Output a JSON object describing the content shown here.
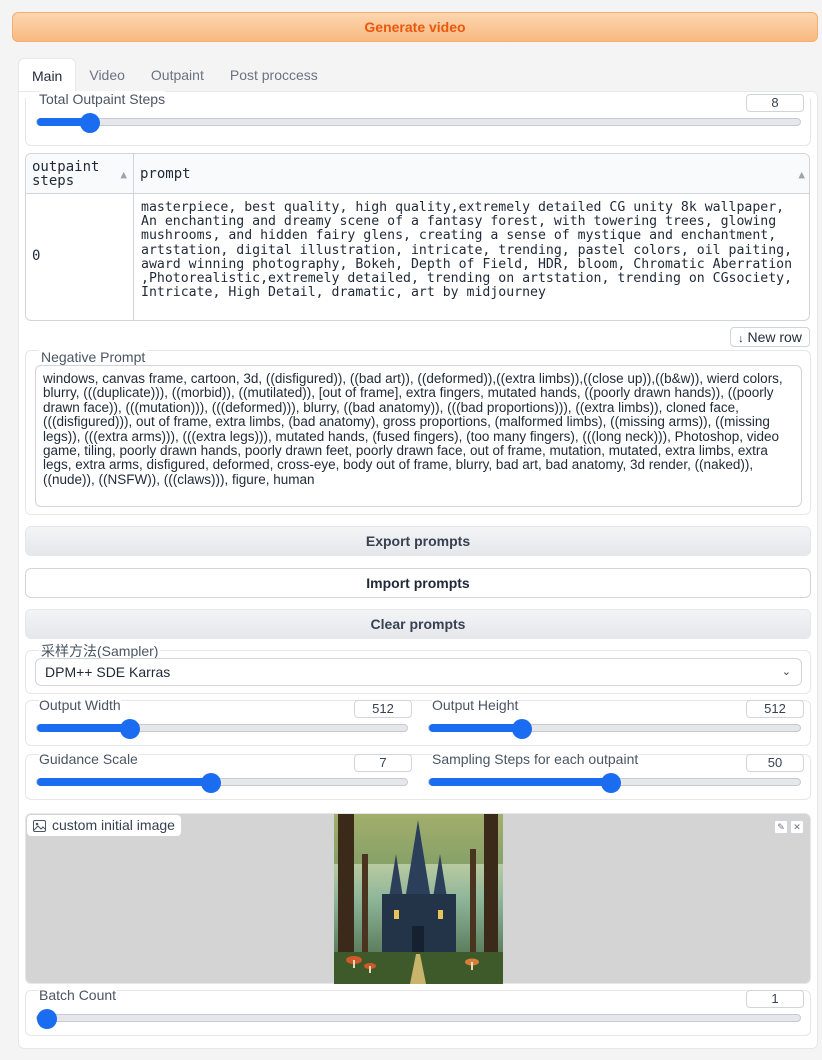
{
  "generate_button": "Generate video",
  "tabs": [
    {
      "label": "Main",
      "active": true
    },
    {
      "label": "Video",
      "active": false
    },
    {
      "label": "Outpaint",
      "active": false
    },
    {
      "label": "Post proccess",
      "active": false
    }
  ],
  "total_outpaint_steps": {
    "label": "Total Outpaint Steps",
    "value": "8",
    "fraction": 0.07
  },
  "prompt_table": {
    "headers": [
      "outpaint steps",
      "prompt"
    ],
    "rows": [
      {
        "step": "0",
        "prompt": "masterpiece, best quality, high quality,extremely detailed CG unity 8k wallpaper, An enchanting and dreamy scene of a fantasy forest, with towering trees, glowing mushrooms, and hidden fairy glens, creating a sense of mystique and enchantment, artstation, digital illustration, intricate, trending, pastel colors, oil paiting, award winning photography, Bokeh, Depth of Field, HDR, bloom, Chromatic Aberration ,Photorealistic,extremely detailed, trending on artstation, trending on CGsociety, Intricate, High Detail, dramatic, art by midjourney"
      }
    ],
    "new_row_label": "New row"
  },
  "negative_prompt": {
    "label": "Negative Prompt",
    "value": "windows, canvas frame, cartoon, 3d, ((disfigured)), ((bad art)), ((deformed)),((extra limbs)),((close up)),((b&w)), wierd colors, blurry, (((duplicate))), ((morbid)), ((mutilated)), [out of frame], extra fingers, mutated hands, ((poorly drawn hands)), ((poorly drawn face)), (((mutation))), (((deformed))), blurry, ((bad anatomy)), (((bad proportions))), ((extra limbs)), cloned face, (((disfigured))), out of frame, extra limbs, (bad anatomy), gross proportions, (malformed limbs), ((missing arms)), ((missing legs)), (((extra arms))), (((extra legs))), mutated hands, (fused fingers), (too many fingers), (((long neck))), Photoshop, video game, tiling, poorly drawn hands, poorly drawn feet, poorly drawn face, out of frame, mutation, mutated, extra limbs, extra legs, extra arms, disfigured, deformed, cross-eye, body out of frame, blurry, bad art, bad anatomy, 3d render, ((naked)), ((nude)), ((NSFW)), (((claws))), figure, human"
  },
  "buttons": {
    "export": "Export prompts",
    "import": "Import prompts",
    "clear": "Clear prompts"
  },
  "sampler": {
    "label": "采样方法(Sampler)",
    "value": "DPM++ SDE Karras"
  },
  "output_width": {
    "label": "Output Width",
    "value": "512",
    "fraction": 0.25
  },
  "output_height": {
    "label": "Output Height",
    "value": "512",
    "fraction": 0.25
  },
  "guidance_scale": {
    "label": "Guidance Scale",
    "value": "7",
    "fraction": 0.47
  },
  "sampling_steps": {
    "label": "Sampling Steps for each outpaint",
    "value": "50",
    "fraction": 0.49
  },
  "custom_image": {
    "label": "custom initial image",
    "edit_icon": "pencil-icon",
    "close_icon": "close-icon"
  },
  "batch_count": {
    "label": "Batch Count",
    "value": "1",
    "fraction": 0.0
  },
  "colors": {
    "accent": "#1a6cf0",
    "generate_text": "#ea580c"
  }
}
